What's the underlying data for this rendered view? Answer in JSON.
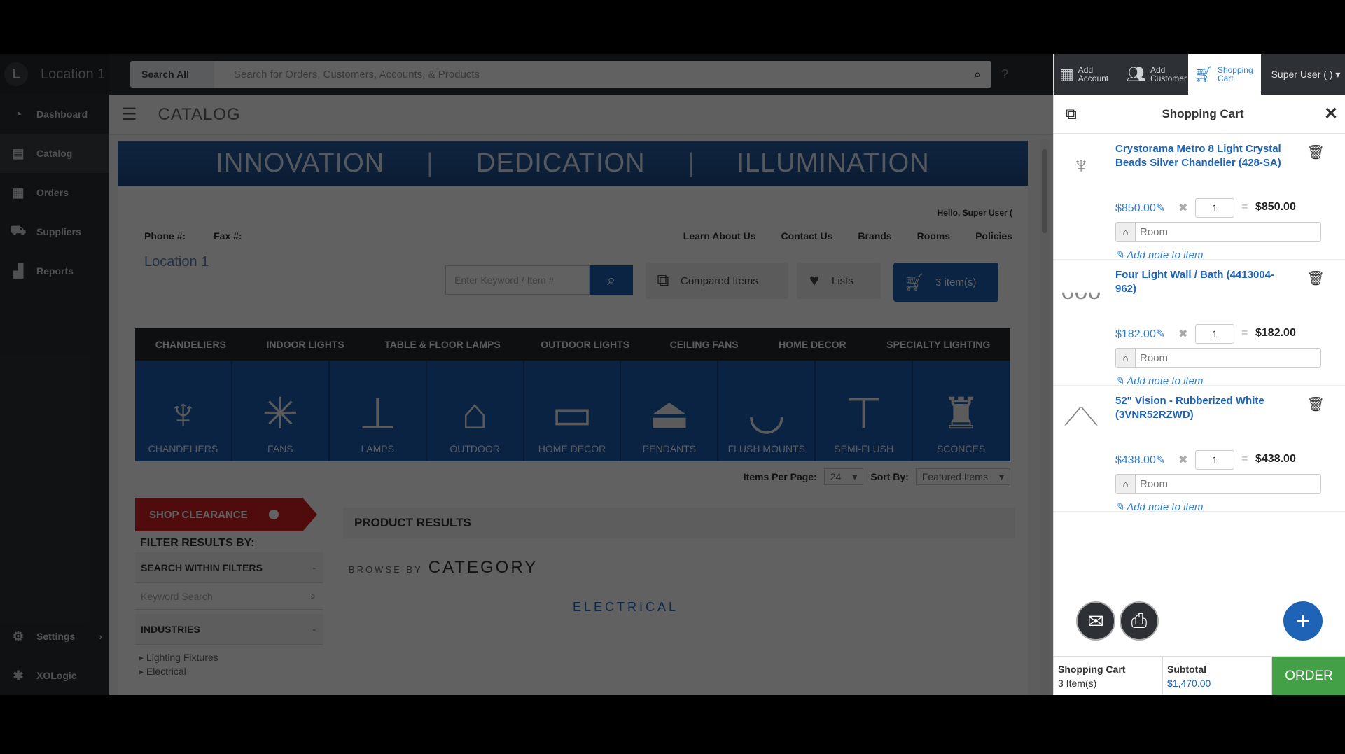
{
  "sidebar": {
    "location_initial": "L",
    "location_name": "Location 1",
    "items": [
      {
        "label": "Dashboard",
        "icon": "dashboard-icon"
      },
      {
        "label": "Catalog",
        "icon": "catalog-icon"
      },
      {
        "label": "Orders",
        "icon": "orders-icon"
      },
      {
        "label": "Suppliers",
        "icon": "truck-icon"
      },
      {
        "label": "Reports",
        "icon": "bar-chart-icon"
      }
    ],
    "settings_label": "Settings",
    "brand_label": "XOLogic"
  },
  "topbar": {
    "search_scope": "Search All",
    "search_placeholder": "Search for Orders, Customers, Accounts, & Products"
  },
  "page": {
    "title": "CATALOG"
  },
  "store": {
    "banner": [
      "INNOVATION",
      "|",
      "DEDICATION",
      "|",
      "ILLUMINATION"
    ],
    "greeting": "Hello, Super User (",
    "phone_label": "Phone #:",
    "fax_label": "Fax #:",
    "links": [
      "Learn About Us",
      "Contact Us",
      "Brands",
      "Rooms",
      "Policies"
    ],
    "logo_alt": "Location 1",
    "keyword_placeholder": "Enter Keyword / Item #",
    "compared_label": "Compared Items",
    "lists_label": "Lists",
    "cart_label": "3 item(s)",
    "category_nav": [
      "CHANDELIERS",
      "INDOOR LIGHTS",
      "TABLE & FLOOR LAMPS",
      "OUTDOOR LIGHTS",
      "CEILING FANS",
      "HOME DECOR",
      "SPECIALTY LIGHTING"
    ],
    "tiles": [
      "CHANDELIERS",
      "FANS",
      "LAMPS",
      "OUTDOOR",
      "HOME DECOR",
      "PENDANTS",
      "FLUSH MOUNTS",
      "SEMI-FLUSH",
      "SCONCES"
    ],
    "items_per_page_label": "Items Per Page:",
    "items_per_page_value": "24",
    "sort_by_label": "Sort By:",
    "sort_by_value": "Featured Items",
    "clearance_label": "SHOP CLEARANCE",
    "filter_title": "FILTER RESULTS BY:",
    "search_within": "SEARCH WITHIN FILTERS",
    "filter_search_placeholder": "Keyword Search",
    "industries_label": "INDUSTRIES",
    "industry_options": [
      "Lighting Fixtures",
      "Electrical"
    ],
    "results_title": "PRODUCT RESULTS",
    "browse_by": "BROWSE BY",
    "browse_category": "CATEGORY",
    "electrical_label": "ELECTRICAL"
  },
  "drawer": {
    "tabs": {
      "add_account": [
        "Add",
        "Account"
      ],
      "add_customer": [
        "Add",
        "Customer"
      ],
      "shopping_cart": [
        "Shopping",
        "Cart"
      ],
      "user": "Super User ( )"
    },
    "title": "Shopping Cart",
    "items": [
      {
        "name": "Crystorama Metro 8 Light Crystal Beads Silver Chandelier (428-SA)",
        "price": "$850.00",
        "qty": "1",
        "total": "$850.00",
        "room_placeholder": "Room",
        "note": "Add note to item"
      },
      {
        "name": "Four Light Wall / Bath (4413004-962)",
        "price": "$182.00",
        "qty": "1",
        "total": "$182.00",
        "room_placeholder": "Room",
        "note": "Add note to item"
      },
      {
        "name": "52\" Vision - Rubberized White (3VNR52RZWD)",
        "price": "$438.00",
        "qty": "1",
        "total": "$438.00",
        "room_placeholder": "Room",
        "note": "Add note to item"
      }
    ],
    "footer": {
      "cart_label": "Shopping Cart",
      "cart_count": "3 Item(s)",
      "subtotal_label": "Subtotal",
      "subtotal_value": "$1,470.00",
      "order_label": "ORDER"
    }
  },
  "colors": {
    "accent_blue": "#1f63b6",
    "order_green": "#43a047",
    "clearance_red": "#d22121",
    "sidebar_dark": "#2b2f33"
  }
}
